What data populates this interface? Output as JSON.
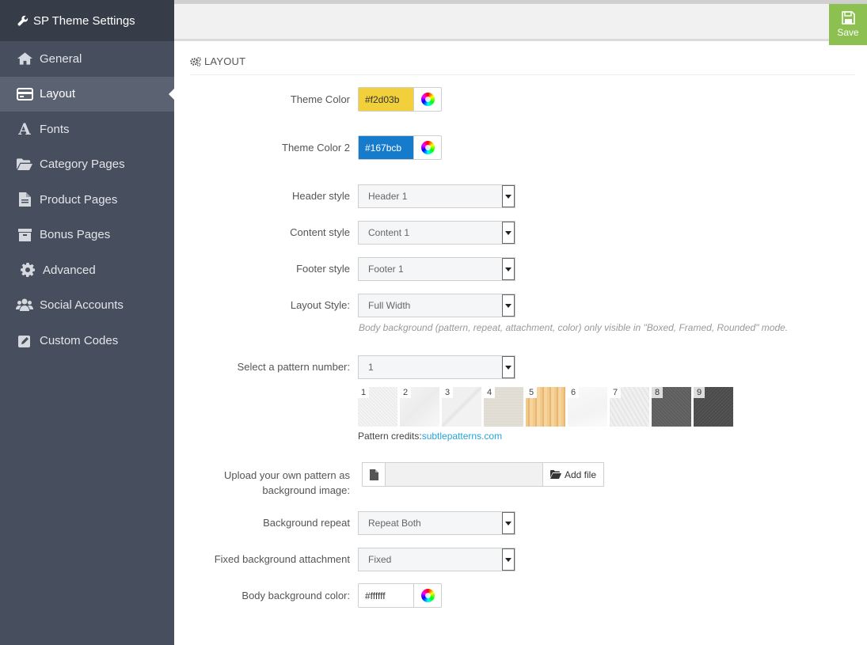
{
  "sidebar": {
    "title": "SP Theme Settings",
    "items": [
      {
        "label": "General",
        "icon": "home-icon",
        "active": false
      },
      {
        "label": "Layout",
        "icon": "layout-icon",
        "active": true
      },
      {
        "label": "Fonts",
        "icon": "font-icon",
        "active": false
      },
      {
        "label": "Category Pages",
        "icon": "folder-icon",
        "active": false
      },
      {
        "label": "Product Pages",
        "icon": "document-icon",
        "active": false
      },
      {
        "label": "Bonus Pages",
        "icon": "archive-icon",
        "active": false
      },
      {
        "label": "Advanced",
        "icon": "gear-icon",
        "active": false
      },
      {
        "label": "Social Accounts",
        "icon": "users-icon",
        "active": false
      },
      {
        "label": "Custom Codes",
        "icon": "edit-icon",
        "active": false
      }
    ]
  },
  "toolbar": {
    "save_label": "Save"
  },
  "section": {
    "title": "LAYOUT"
  },
  "form": {
    "theme_color": {
      "label": "Theme Color",
      "value": "#f2d03b"
    },
    "theme_color2": {
      "label": "Theme Color 2",
      "value": "#167bcb"
    },
    "header_style": {
      "label": "Header style",
      "value": "Header 1"
    },
    "content_style": {
      "label": "Content style",
      "value": "Content 1"
    },
    "footer_style": {
      "label": "Footer style",
      "value": "Footer 1"
    },
    "layout_style": {
      "label": "Layout Style:",
      "value": "Full Width",
      "hint": "Body background (pattern, repeat, attachment, color) only visible in \"Boxed, Framed, Rounded\" mode."
    },
    "pattern_number": {
      "label": "Select a pattern number:",
      "value": "1"
    },
    "patterns": [
      "1",
      "2",
      "3",
      "4",
      "5",
      "6",
      "7",
      "8",
      "9"
    ],
    "pattern_credits": {
      "prefix": "Pattern credits:",
      "link": "subtlepatterns.com"
    },
    "upload": {
      "label_line1": "Upload your own pattern as",
      "label_line2": "background image:",
      "button": "Add file"
    },
    "bg_repeat": {
      "label": "Background repeat",
      "value": "Repeat Both"
    },
    "bg_attachment": {
      "label": "Fixed background attachment",
      "value": "Fixed"
    },
    "body_bg_color": {
      "label": "Body background color:",
      "value": "#ffffff"
    }
  },
  "colors": {
    "sidebar_bg": "#474e5d",
    "sidebar_header": "#363c48",
    "sidebar_active": "#5b6271",
    "save_green": "#8cc152",
    "link_blue": "#25a6d9"
  }
}
